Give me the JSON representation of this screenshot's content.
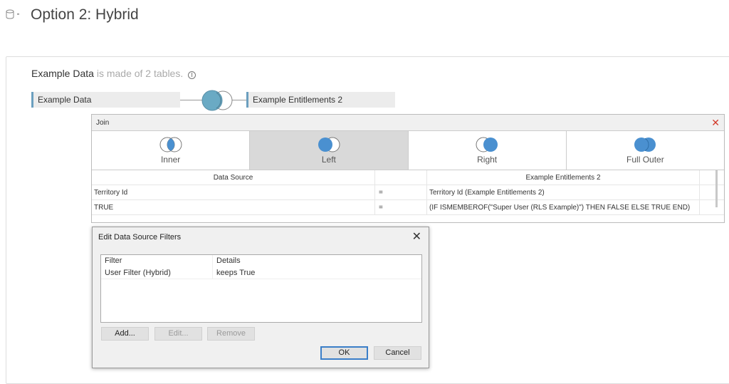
{
  "page": {
    "title": "Option 2: Hybrid"
  },
  "summary": {
    "source_name": "Example Data",
    "suffix": "is made of 2 tables."
  },
  "tables": {
    "left": "Example Data",
    "right": "Example Entitlements 2"
  },
  "join": {
    "title": "Join",
    "types": [
      {
        "label": "Inner"
      },
      {
        "label": "Left",
        "selected": true
      },
      {
        "label": "Right"
      },
      {
        "label": "Full Outer"
      }
    ],
    "columns": [
      "Data Source",
      "",
      "Example Entitlements 2"
    ],
    "rows": [
      {
        "left": "Territory Id",
        "op": "=",
        "right": "Territory Id (Example Entitlements 2)"
      },
      {
        "left": "TRUE",
        "op": "=",
        "right": "(IF ISMEMBEROF(\"Super User (RLS Example)\") THEN FALSE ELSE TRUE END)"
      }
    ]
  },
  "dialog": {
    "title": "Edit Data Source Filters",
    "columns": [
      "Filter",
      "Details"
    ],
    "rows": [
      {
        "filter": "User Filter (Hybrid)",
        "details": "keeps True"
      }
    ],
    "add": "Add...",
    "edit": "Edit...",
    "remove": "Remove",
    "ok": "OK",
    "cancel": "Cancel"
  },
  "colors": {
    "accent": "#4a90d0",
    "venn": "#6aaac4",
    "close": "#d23a2a"
  }
}
